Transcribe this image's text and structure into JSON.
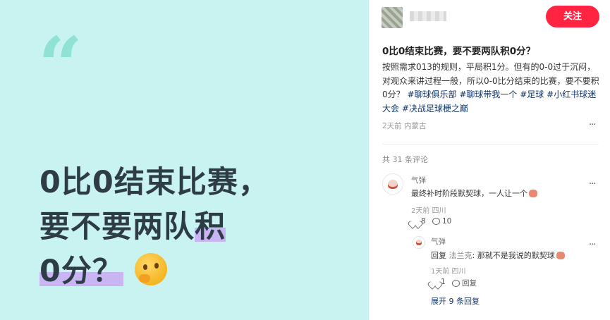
{
  "cover": {
    "quote_mark": "“",
    "title_lines": [
      "0比0结束比赛，",
      "要不要两队积",
      "0分？"
    ],
    "emoji": "thinking-face"
  },
  "author": {
    "follow_label": "关注"
  },
  "post": {
    "title": "0比0结束比赛，要不要两队积0分？",
    "body_text": "按照需求013的规则，平局积1分。但有的0-0过于沉闷，对观众来讲过程一般，所以0-0比分结束的比赛，要不要积0分？",
    "tags": [
      "#聊球俱乐部",
      "#聊球带我一个",
      "#足球",
      "#小红书球迷大会",
      "#决战足球梗之巅"
    ],
    "meta": "2天前 内蒙古"
  },
  "comments_header": "共 31 条评论",
  "comments": [
    {
      "name": "气弹",
      "text": "最终补时阶段默契球，一人让一个",
      "meta": "2天前 四川",
      "likes": "8",
      "replies": "10"
    }
  ],
  "reply": {
    "name": "气弹",
    "prefix": "回复 ",
    "mention": "法兰克",
    "text": ": 那就不是我说的默契球",
    "meta": "1天前 四川",
    "likes": "1",
    "reply_label": "回复"
  },
  "expand_label": "展开 9 条回复",
  "more_glyph": "···",
  "colors": {
    "accent": "#ff2442",
    "tag": "#13386c",
    "cover_bg": "#c8f3f0",
    "highlight": "#c9b5f4"
  }
}
